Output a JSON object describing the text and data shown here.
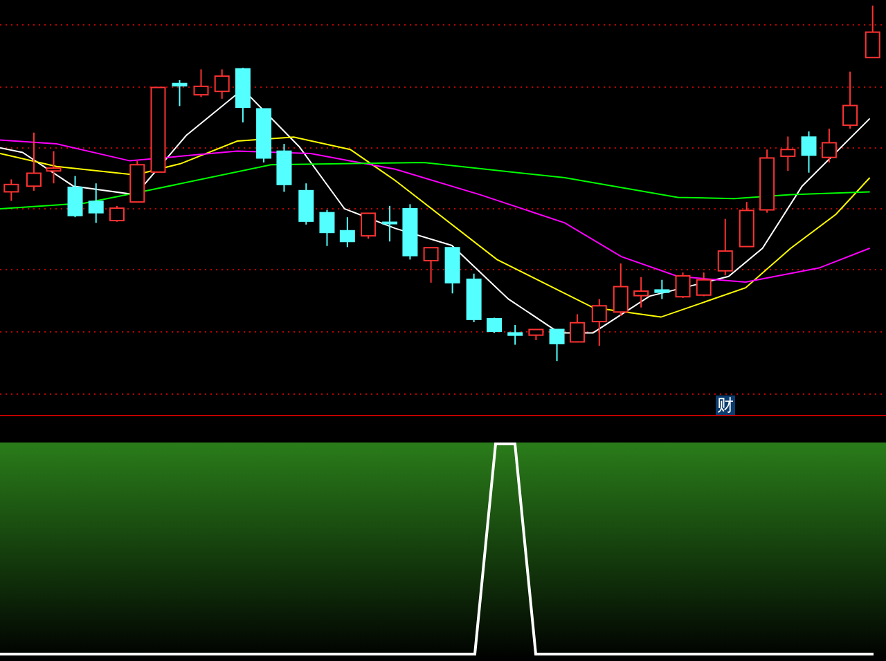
{
  "price_chart": {
    "finance_badge": {
      "label": "财"
    }
  }
}
